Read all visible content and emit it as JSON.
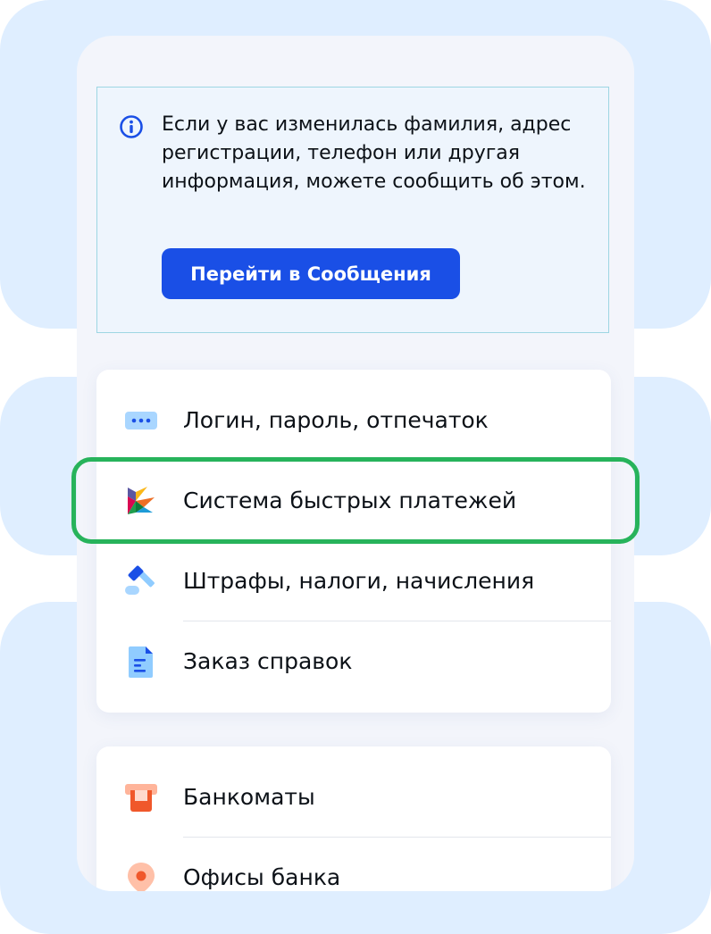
{
  "notice": {
    "text": "Если у вас изменилась фамилия, адрес регистрации, телефон или другая информация, можете сообщить об этом.",
    "button_label": "Перейти в Сообщения"
  },
  "menu_group_1": [
    {
      "label": "Логин, пароль, отпечаток",
      "icon": "password-dots-icon"
    },
    {
      "label": "Система быстрых платежей",
      "icon": "sbp-logo-icon"
    },
    {
      "label": "Штрафы, налоги, начисления",
      "icon": "gavel-icon"
    },
    {
      "label": "Заказ справок",
      "icon": "document-icon"
    }
  ],
  "menu_group_2": [
    {
      "label": "Банкоматы",
      "icon": "atm-icon"
    },
    {
      "label": "Офисы банка",
      "icon": "location-pin-icon"
    }
  ],
  "colors": {
    "accent": "#1a4fe6",
    "highlight": "#27b35b",
    "background_blob": "#dfeeff",
    "notice_bg": "#eef5fd"
  }
}
